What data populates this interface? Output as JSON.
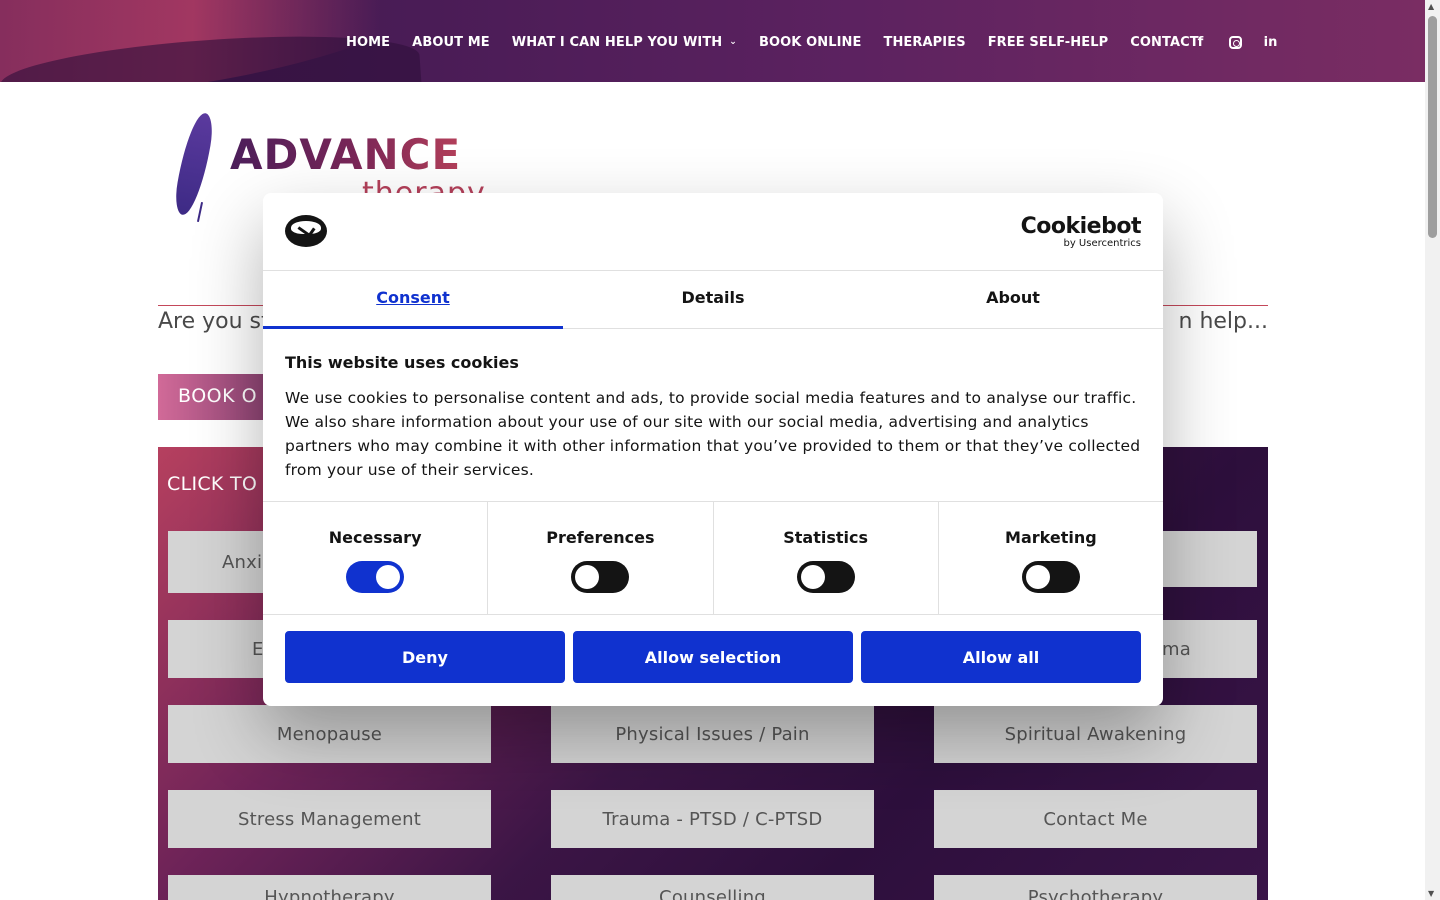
{
  "nav": {
    "items": [
      "HOME",
      "ABOUT ME",
      "WHAT I CAN HELP YOU WITH",
      "BOOK ONLINE",
      "THERAPIES",
      "FREE SELF-HELP",
      "CONTACT"
    ],
    "dropdown_caret": "⌄",
    "social": [
      "facebook-icon",
      "instagram-icon",
      "linkedin-icon"
    ],
    "facebook_glyph": "f",
    "linkedin_glyph": "in"
  },
  "logo": {
    "word1": "ADVANCE",
    "word2": "therapy"
  },
  "page": {
    "headline_left": "Are you st",
    "headline_right": "n help...",
    "book_button": "BOOK O",
    "panel_title": "CLICK TO",
    "chips": [
      "Anxi",
      "",
      "E",
      "ma",
      "Menopause",
      "Physical Issues / Pain",
      "Spiritual Awakening",
      "Stress Management",
      "Trauma - PTSD / C-PTSD",
      "Contact Me",
      "Hypnotherapy",
      "Counselling",
      "Psychotherapy"
    ]
  },
  "cookie": {
    "brand": "Cookiebot",
    "brand_sub": "by Usercentrics",
    "tabs": [
      "Consent",
      "Details",
      "About"
    ],
    "active_tab": "Consent",
    "title": "This website uses cookies",
    "text": "We use cookies to personalise content and ads, to provide social media features and to analyse our traffic. We also share information about your use of our site with our social media, advertising and analytics partners who may combine it with other information that you’ve provided to them or that they’ve collected from your use of their services.",
    "toggles": [
      {
        "label": "Necessary",
        "on": true
      },
      {
        "label": "Preferences",
        "on": false
      },
      {
        "label": "Statistics",
        "on": false
      },
      {
        "label": "Marketing",
        "on": false
      }
    ],
    "buttons": {
      "deny": "Deny",
      "allow_selection": "Allow selection",
      "allow_all": "Allow all"
    },
    "accent": "#1032cf"
  }
}
